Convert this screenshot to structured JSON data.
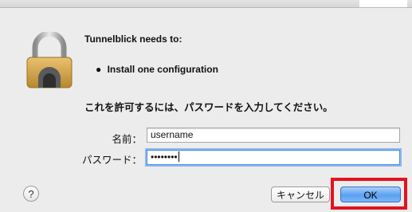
{
  "message": {
    "heading": "Tunnelblick needs to:",
    "bullet": "●",
    "items": [
      "Install one configuration"
    ],
    "prompt": "これを許可するには、パスワードを入力してください。"
  },
  "form": {
    "name_label": "名前：",
    "name_value": "username",
    "password_label": "パスワード：",
    "password_value": "••••••••"
  },
  "buttons": {
    "help": "?",
    "cancel": "キャンセル",
    "ok": "OK"
  },
  "icons": {
    "lock": "lock-icon",
    "help": "question-mark-icon"
  },
  "colors": {
    "highlight": "#e0141e",
    "default_button": "#5aa0f2",
    "focus_ring": "#8ab8f0"
  }
}
